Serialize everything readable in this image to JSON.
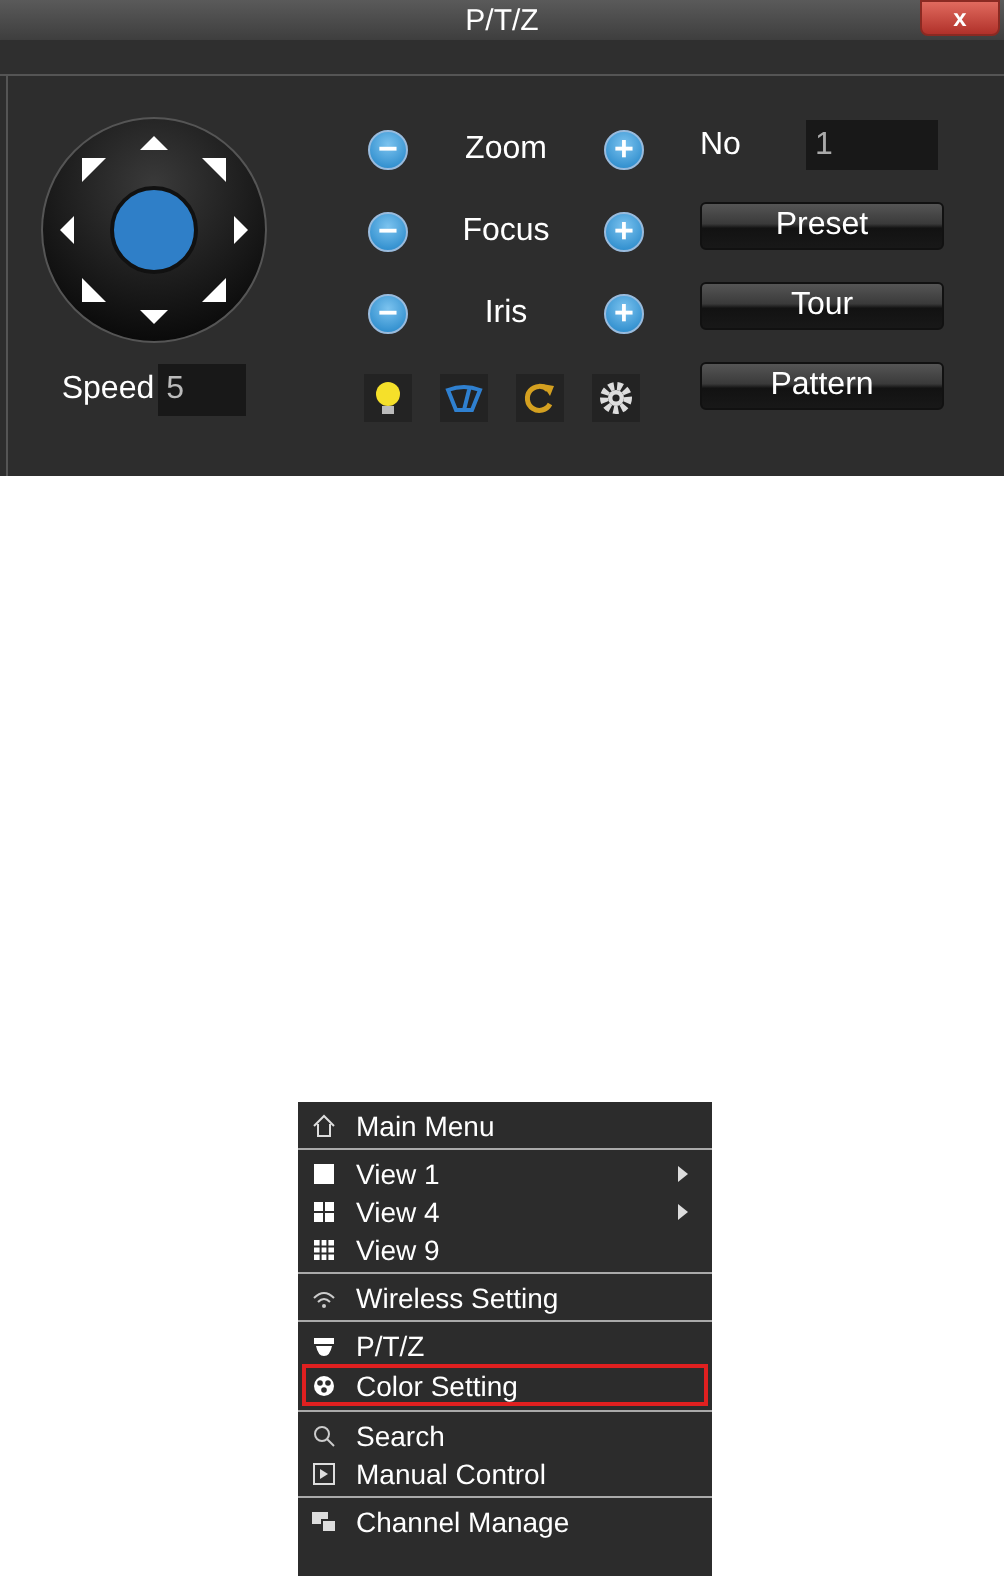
{
  "window": {
    "title": "P/T/Z",
    "close_label": "x"
  },
  "ptz": {
    "speed_label": "Speed",
    "speed_value": "5",
    "adjust_rows": [
      {
        "minus": "−",
        "label": "Zoom",
        "plus": "+"
      },
      {
        "minus": "−",
        "label": "Focus",
        "plus": "+"
      },
      {
        "minus": "−",
        "label": "Iris",
        "plus": "+"
      }
    ],
    "no_label": "No",
    "no_value": "1",
    "buttons": [
      "Preset",
      "Tour",
      "Pattern"
    ]
  },
  "context_menu": {
    "groups": [
      [
        {
          "label": "Main Menu",
          "submenu": false,
          "selected": false
        }
      ],
      [
        {
          "label": "View 1",
          "submenu": true,
          "selected": false
        },
        {
          "label": "View 4",
          "submenu": true,
          "selected": false
        },
        {
          "label": "View 9",
          "submenu": false,
          "selected": false
        }
      ],
      [
        {
          "label": "Wireless Setting",
          "submenu": false,
          "selected": false
        }
      ],
      [
        {
          "label": "P/T/Z",
          "submenu": false,
          "selected": false
        },
        {
          "label": "Color Setting",
          "submenu": false,
          "selected": true
        }
      ],
      [
        {
          "label": "Search",
          "submenu": false,
          "selected": false
        },
        {
          "label": "Manual Control",
          "submenu": false,
          "selected": false
        }
      ],
      [
        {
          "label": "Channel Manage",
          "submenu": false,
          "selected": false
        }
      ]
    ]
  }
}
